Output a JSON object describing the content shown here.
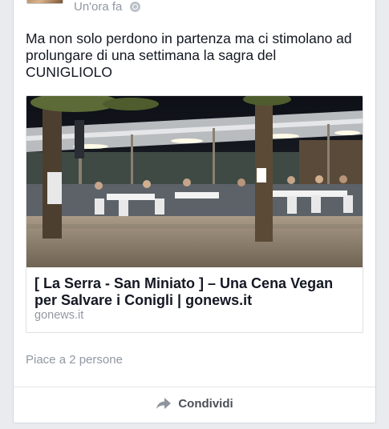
{
  "post": {
    "timestamp": "Un'ora fa",
    "privacy_icon": "globe-icon",
    "text": "Ma non solo perdono in partenza ma ci stimolano ad prolungare di una settimana la sagra del CUNIGLIOLO"
  },
  "link": {
    "title": "[ La Serra - San Miniato ] – Una Cena Vegan per Salvare i Conigli | gonews.it",
    "domain": "gonews.it"
  },
  "footer": {
    "likes_text": "Piace a 2 persone",
    "share_label": "Condividi",
    "share_icon": "share-arrow-icon"
  }
}
